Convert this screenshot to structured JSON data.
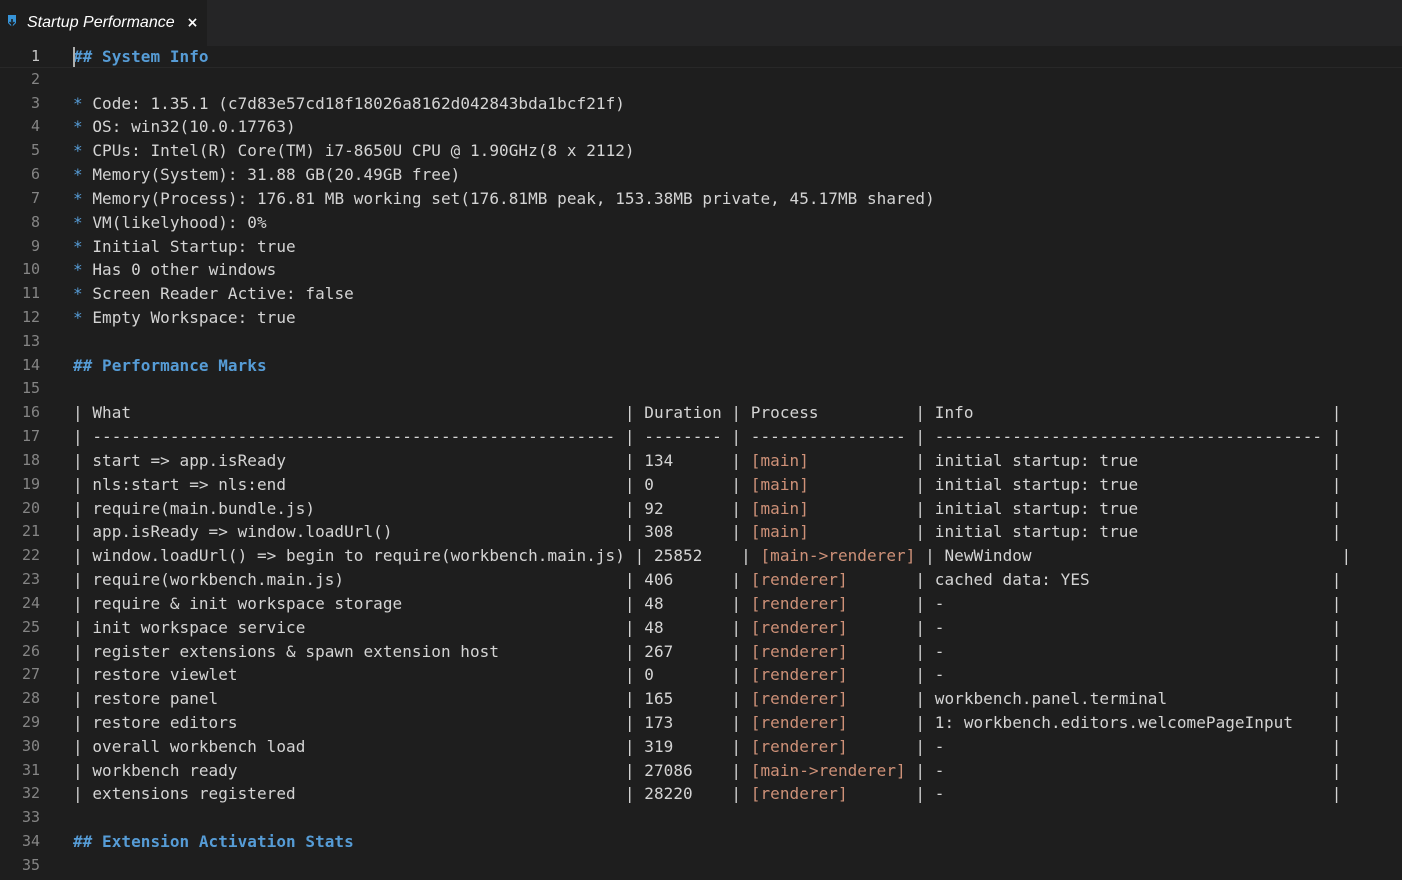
{
  "tab": {
    "label": "Startup Performance",
    "close": "×",
    "icon": "vscode-icon"
  },
  "colors": {
    "heading": "#569cd6",
    "process": "#ce9178",
    "text": "#d4d4d4",
    "line_number": "#858585"
  },
  "editor": {
    "lines": [
      {
        "n": "1",
        "parts": [
          {
            "t": "## System Info",
            "c": "heading"
          }
        ]
      },
      {
        "n": "2",
        "parts": []
      },
      {
        "n": "3",
        "parts": [
          {
            "t": "* ",
            "c": "bullet"
          },
          {
            "t": "Code: 1.35.1 (c7d83e57cd18f18026a8162d042843bda1bcf21f)"
          }
        ]
      },
      {
        "n": "4",
        "parts": [
          {
            "t": "* ",
            "c": "bullet"
          },
          {
            "t": "OS: win32(10.0.17763)"
          }
        ]
      },
      {
        "n": "5",
        "parts": [
          {
            "t": "* ",
            "c": "bullet"
          },
          {
            "t": "CPUs: Intel(R) Core(TM) i7-8650U CPU @ 1.90GHz(8 x 2112)"
          }
        ]
      },
      {
        "n": "6",
        "parts": [
          {
            "t": "* ",
            "c": "bullet"
          },
          {
            "t": "Memory(System): 31.88 GB(20.49GB free)"
          }
        ]
      },
      {
        "n": "7",
        "parts": [
          {
            "t": "* ",
            "c": "bullet"
          },
          {
            "t": "Memory(Process): 176.81 MB working set(176.81MB peak, 153.38MB private, 45.17MB shared)"
          }
        ]
      },
      {
        "n": "8",
        "parts": [
          {
            "t": "* ",
            "c": "bullet"
          },
          {
            "t": "VM(likelyhood): 0%"
          }
        ]
      },
      {
        "n": "9",
        "parts": [
          {
            "t": "* ",
            "c": "bullet"
          },
          {
            "t": "Initial Startup: true"
          }
        ]
      },
      {
        "n": "10",
        "parts": [
          {
            "t": "* ",
            "c": "bullet"
          },
          {
            "t": "Has 0 other windows"
          }
        ]
      },
      {
        "n": "11",
        "parts": [
          {
            "t": "* ",
            "c": "bullet"
          },
          {
            "t": "Screen Reader Active: false"
          }
        ]
      },
      {
        "n": "12",
        "parts": [
          {
            "t": "* ",
            "c": "bullet"
          },
          {
            "t": "Empty Workspace: true"
          }
        ]
      },
      {
        "n": "13",
        "parts": []
      },
      {
        "n": "14",
        "parts": [
          {
            "t": "## Performance Marks",
            "c": "heading"
          }
        ]
      },
      {
        "n": "15",
        "parts": []
      },
      {
        "n": "16",
        "parts": [
          {
            "t": "| What                                                   | Duration | Process          | Info                                     |"
          }
        ]
      },
      {
        "n": "17",
        "parts": [
          {
            "t": "| ------------------------------------------------------ | -------- | ---------------- | ---------------------------------------- |"
          }
        ]
      },
      {
        "n": "18",
        "parts": [
          {
            "t": "| start => app.isReady                                   | 134      | "
          },
          {
            "t": "[main]",
            "c": "proc"
          },
          {
            "t": "           | initial startup: true                    |"
          }
        ]
      },
      {
        "n": "19",
        "parts": [
          {
            "t": "| nls:start => nls:end                                   | 0        | "
          },
          {
            "t": "[main]",
            "c": "proc"
          },
          {
            "t": "           | initial startup: true                    |"
          }
        ]
      },
      {
        "n": "20",
        "parts": [
          {
            "t": "| require(main.bundle.js)                                | 92       | "
          },
          {
            "t": "[main]",
            "c": "proc"
          },
          {
            "t": "           | initial startup: true                    |"
          }
        ]
      },
      {
        "n": "21",
        "parts": [
          {
            "t": "| app.isReady => window.loadUrl()                        | 308      | "
          },
          {
            "t": "[main]",
            "c": "proc"
          },
          {
            "t": "           | initial startup: true                    |"
          }
        ]
      },
      {
        "n": "22",
        "parts": [
          {
            "t": "| window.loadUrl() => begin to require(workbench.main.js) | 25852    | "
          },
          {
            "t": "[main->renderer]",
            "c": "proc"
          },
          {
            "t": " | NewWindow                                |"
          }
        ]
      },
      {
        "n": "23",
        "parts": [
          {
            "t": "| require(workbench.main.js)                             | 406      | "
          },
          {
            "t": "[renderer]",
            "c": "proc"
          },
          {
            "t": "       | cached data: YES                         |"
          }
        ]
      },
      {
        "n": "24",
        "parts": [
          {
            "t": "| require & init workspace storage                       | 48       | "
          },
          {
            "t": "[renderer]",
            "c": "proc"
          },
          {
            "t": "       | -                                        |"
          }
        ]
      },
      {
        "n": "25",
        "parts": [
          {
            "t": "| init workspace service                                 | 48       | "
          },
          {
            "t": "[renderer]",
            "c": "proc"
          },
          {
            "t": "       | -                                        |"
          }
        ]
      },
      {
        "n": "26",
        "parts": [
          {
            "t": "| register extensions & spawn extension host             | 267      | "
          },
          {
            "t": "[renderer]",
            "c": "proc"
          },
          {
            "t": "       | -                                        |"
          }
        ]
      },
      {
        "n": "27",
        "parts": [
          {
            "t": "| restore viewlet                                        | 0        | "
          },
          {
            "t": "[renderer]",
            "c": "proc"
          },
          {
            "t": "       | -                                        |"
          }
        ]
      },
      {
        "n": "28",
        "parts": [
          {
            "t": "| restore panel                                          | 165      | "
          },
          {
            "t": "[renderer]",
            "c": "proc"
          },
          {
            "t": "       | workbench.panel.terminal                 |"
          }
        ]
      },
      {
        "n": "29",
        "parts": [
          {
            "t": "| restore editors                                        | 173      | "
          },
          {
            "t": "[renderer]",
            "c": "proc"
          },
          {
            "t": "       | 1: workbench.editors.welcomePageInput    |"
          }
        ]
      },
      {
        "n": "30",
        "parts": [
          {
            "t": "| overall workbench load                                 | 319      | "
          },
          {
            "t": "[renderer]",
            "c": "proc"
          },
          {
            "t": "       | -                                        |"
          }
        ]
      },
      {
        "n": "31",
        "parts": [
          {
            "t": "| workbench ready                                        | 27086    | "
          },
          {
            "t": "[main->renderer]",
            "c": "proc"
          },
          {
            "t": " | -                                        |"
          }
        ]
      },
      {
        "n": "32",
        "parts": [
          {
            "t": "| extensions registered                                  | 28220    | "
          },
          {
            "t": "[renderer]",
            "c": "proc"
          },
          {
            "t": "       | -                                        |"
          }
        ]
      },
      {
        "n": "33",
        "parts": []
      },
      {
        "n": "34",
        "parts": [
          {
            "t": "## Extension Activation Stats",
            "c": "heading"
          }
        ]
      },
      {
        "n": "35",
        "parts": []
      }
    ]
  }
}
